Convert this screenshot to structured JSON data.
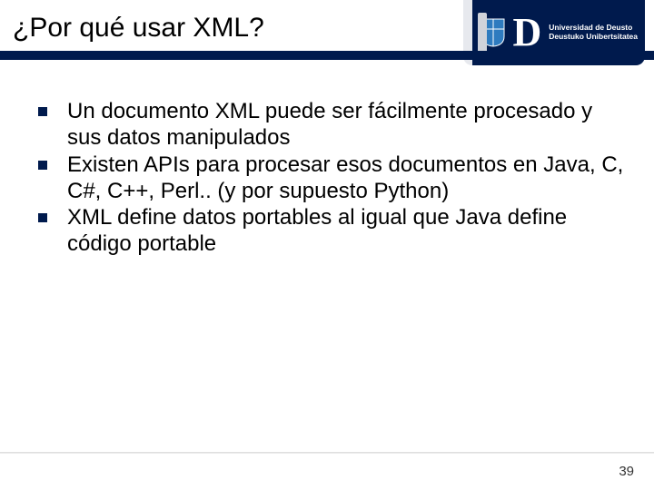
{
  "title": "¿Por qué usar XML?",
  "logo": {
    "line1": "Universidad de Deusto",
    "line2": "Deustuko Unibertsitatea",
    "letter": "D"
  },
  "bullets": [
    "Un documento XML puede ser fácilmente procesado y sus datos manipulados",
    "Existen APIs para procesar esos documentos en Java, C, C#, C++, Perl.. (y por supuesto Python)",
    "XML define datos portables al igual que Java define código portable"
  ],
  "page_number": "39"
}
